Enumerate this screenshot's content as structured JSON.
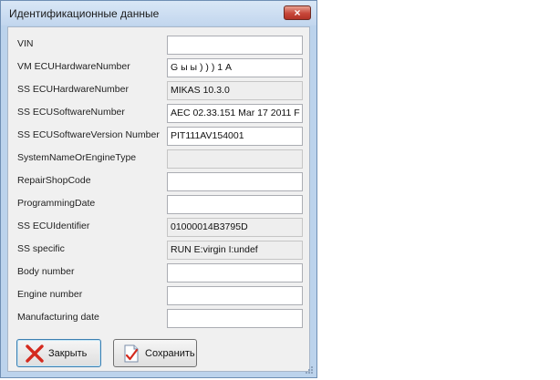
{
  "window": {
    "title": "Идентификационные данные",
    "close_label": "×"
  },
  "fields": [
    {
      "label": "VIN",
      "value": "",
      "readonly": false
    },
    {
      "label": "VM ECUHardwareNumber",
      "value": "G ы ы ) ) ) 1 A",
      "readonly": false
    },
    {
      "label": "SS ECUHardwareNumber",
      "value": "MIKAS 10.3.0",
      "readonly": true
    },
    {
      "label": "SS ECUSoftwareNumber",
      "value": "AEC 02.33.151  Mar 17 2011 F",
      "readonly": false
    },
    {
      "label": "SS ECUSoftwareVersion Number",
      "value": "PIT111AV154001",
      "readonly": false
    },
    {
      "label": "SystemNameOrEngineType",
      "value": "",
      "readonly": true
    },
    {
      "label": "RepairShopCode",
      "value": "",
      "readonly": false
    },
    {
      "label": "ProgrammingDate",
      "value": "",
      "readonly": false
    },
    {
      "label": "SS ECUIdentifier",
      "value": "01000014B3795D",
      "readonly": true
    },
    {
      "label": "SS specific",
      "value": "RUN  E:virgin  I:undef",
      "readonly": true
    },
    {
      "label": "Body number",
      "value": "",
      "readonly": false
    },
    {
      "label": "Engine number",
      "value": "",
      "readonly": false
    },
    {
      "label": "Manufacturing date",
      "value": "",
      "readonly": false
    }
  ],
  "buttons": {
    "close_label": "Закрыть",
    "save_label": "Сохранить"
  },
  "icons": {
    "close": "red-x-icon",
    "save": "document-checkmark-icon"
  }
}
